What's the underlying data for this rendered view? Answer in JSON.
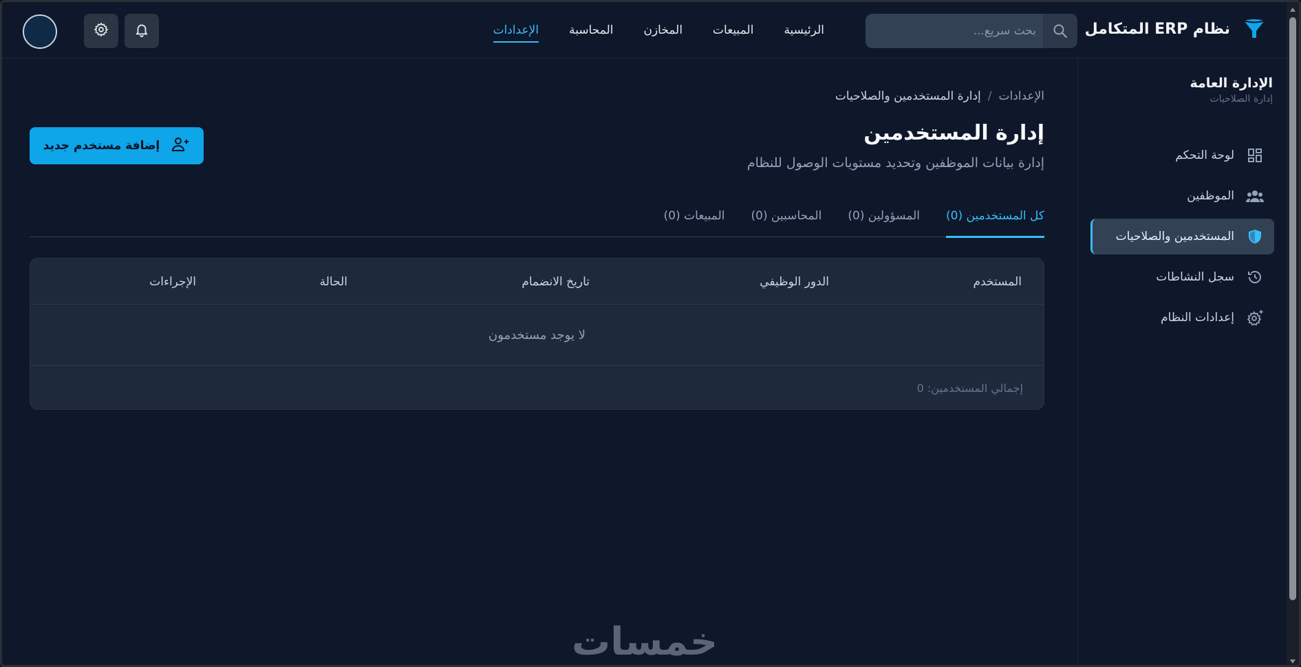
{
  "brand": {
    "title": "نظام ERP المتكامل"
  },
  "search": {
    "placeholder": "بحث سريع..."
  },
  "nav": {
    "items": [
      {
        "label": "الرئيسية"
      },
      {
        "label": "المبيعات"
      },
      {
        "label": "المخازن"
      },
      {
        "label": "المحاسبة"
      },
      {
        "label": "الإعدادات",
        "active": true
      }
    ]
  },
  "sidebar": {
    "title": "الإدارة العامة",
    "subtitle": "إدارة الصلاحيات",
    "items": [
      {
        "label": "لوحة التحكم",
        "icon": "dashboard-icon"
      },
      {
        "label": "الموظفين",
        "icon": "users-group-icon"
      },
      {
        "label": "المستخدمين والصلاحيات",
        "icon": "shield-icon",
        "active": true
      },
      {
        "label": "سجل النشاطات",
        "icon": "history-icon"
      },
      {
        "label": "إعدادات النظام",
        "icon": "gear-icon"
      }
    ]
  },
  "breadcrumb": {
    "parent": "الإعدادات",
    "separator": "/",
    "current": "إدارة المستخدمين والصلاحيات"
  },
  "page": {
    "title": "إدارة المستخدمين",
    "subtitle": "إدارة بيانات الموظفين وتحديد مستويات الوصول للنظام",
    "add_button": "إضافة مستخدم جديد"
  },
  "tabs": [
    {
      "label": "كل المستخدمين (0)",
      "active": true
    },
    {
      "label": "المسؤولين (0)"
    },
    {
      "label": "المحاسبين (0)"
    },
    {
      "label": "المبيعات (0)"
    }
  ],
  "table": {
    "columns": [
      "المستخدم",
      "الدور الوظيفي",
      "تاريخ الانضمام",
      "الحالة",
      "الإجراءات"
    ],
    "empty_message": "لا يوجد مستخدمون",
    "footer": "إجمالي المستخدمين: 0"
  },
  "watermark": "خمسات",
  "colors": {
    "accent": "#38bdf8",
    "button": "#0ea5e9",
    "background": "#0f172a",
    "card": "#1e293b"
  }
}
